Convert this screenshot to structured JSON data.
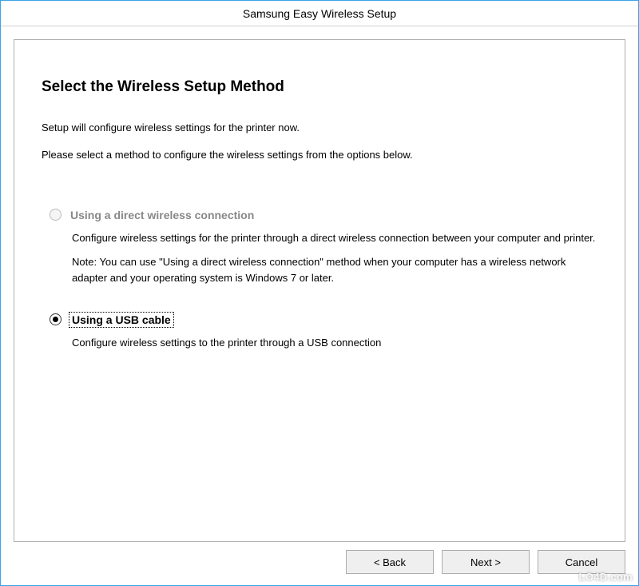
{
  "window": {
    "title": "Samsung Easy Wireless Setup"
  },
  "page": {
    "heading": "Select the Wireless Setup Method",
    "intro1": "Setup will configure wireless settings for the printer now.",
    "intro2": "Please select a method to configure the wireless settings from the options below."
  },
  "options": {
    "direct": {
      "label": "Using a direct wireless connection",
      "desc": "Configure wireless settings for the printer through a direct wireless connection between your computer and printer.",
      "note": "Note: You can use \"Using a direct wireless connection\" method when your computer has a wireless network adapter and your operating system is Windows 7 or later.",
      "enabled": false,
      "selected": false
    },
    "usb": {
      "label": "Using a USB cable",
      "desc": "Configure wireless settings to the printer through a USB connection",
      "enabled": true,
      "selected": true
    }
  },
  "buttons": {
    "back": "< Back",
    "next": "Next >",
    "cancel": "Cancel"
  },
  "watermark": "LO4D.com"
}
